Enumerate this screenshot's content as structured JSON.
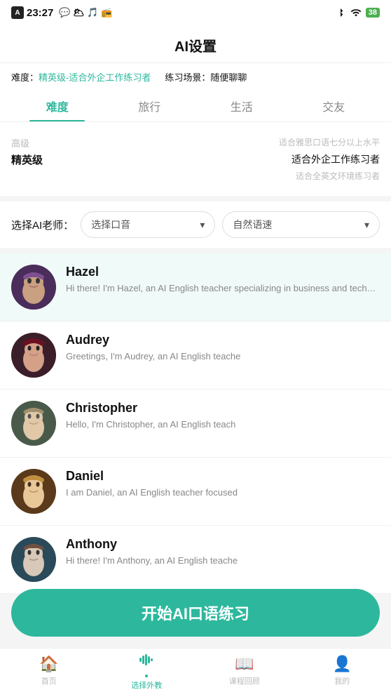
{
  "statusBar": {
    "appIcon": "A",
    "time": "23:27",
    "batteryLevel": "38"
  },
  "notifBar": {
    "time": "23:27",
    "icons": [
      "📱",
      "💬",
      "☁️",
      "🎵",
      "📻"
    ]
  },
  "header": {
    "title": "AI设置"
  },
  "infoBar": {
    "diffLabel": "难度：",
    "diffValue": "精英级-适合外企工作练习者",
    "sceneLabel": "练习场景：",
    "sceneValue": "随便聊聊"
  },
  "tabs": [
    {
      "id": "difficulty",
      "label": "难度",
      "active": true
    },
    {
      "id": "travel",
      "label": "旅行",
      "active": false
    },
    {
      "id": "life",
      "label": "生活",
      "active": false
    },
    {
      "id": "social",
      "label": "交友",
      "active": false
    }
  ],
  "difficultySection": {
    "row1Left": "高级",
    "row1Right": "适合雅思口语七分以上水平",
    "row2Left": "精英级",
    "row2Right": "适合外企工作练习者",
    "row3Right": "适合全英文环境练习者"
  },
  "teacherSelector": {
    "label": "选择AI老师：",
    "accentDropdown": {
      "placeholder": "选择口音",
      "icon": "▾"
    },
    "speedDropdown": {
      "value": "自然语速",
      "icon": "▾"
    }
  },
  "teachers": [
    {
      "id": "hazel",
      "name": "Hazel",
      "desc": "Hi there! I'm Hazel, an AI English teacher specializing in business and technical writing. My aim is to help you improve",
      "selected": true,
      "avatarClass": "avatar-hazel"
    },
    {
      "id": "audrey",
      "name": "Audrey",
      "desc": "Greetings, I'm Audrey, an AI English teache",
      "selected": false,
      "avatarClass": "avatar-audrey"
    },
    {
      "id": "christopher",
      "name": "Christopher",
      "desc": "Hello, I'm Christopher, an AI English teach",
      "selected": false,
      "avatarClass": "avatar-christopher"
    },
    {
      "id": "daniel",
      "name": "Daniel",
      "desc": "I am Daniel, an AI English teacher focused",
      "selected": false,
      "avatarClass": "avatar-daniel"
    },
    {
      "id": "anthony",
      "name": "Anthony",
      "desc": "Hi there! I'm Anthony, an AI English teache",
      "selected": false,
      "avatarClass": "avatar-anthony"
    }
  ],
  "startButton": {
    "label": "开始AI口语练习"
  },
  "bottomNav": [
    {
      "id": "home",
      "label": "首页",
      "icon": "🏠",
      "active": false
    },
    {
      "id": "select-teacher",
      "label": "选择外教",
      "icon": "🎙",
      "active": true
    },
    {
      "id": "course-review",
      "label": "课程回顾",
      "icon": "📖",
      "active": false
    },
    {
      "id": "profile",
      "label": "我的",
      "icon": "👤",
      "active": false
    }
  ]
}
